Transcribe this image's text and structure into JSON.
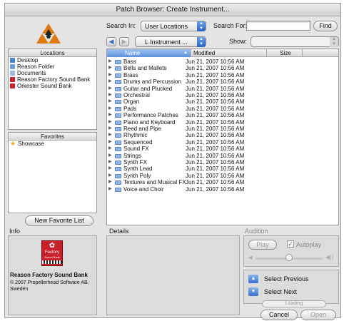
{
  "window": {
    "title": "Patch Browser: Create Instrument..."
  },
  "search": {
    "search_in_label": "Search In:",
    "search_in_value": "User Locations",
    "search_for_label": "Search For:",
    "search_for_value": "",
    "find_label": "Find"
  },
  "toolbar": {
    "path_value": "L Instrument ...",
    "show_label": "Show:",
    "show_value": ""
  },
  "locations": {
    "header": "Locations",
    "items": [
      {
        "label": "Desktop",
        "color": "#4a7fd1"
      },
      {
        "label": "Reason Folder",
        "color": "#6d9bd8"
      },
      {
        "label": "Documents",
        "color": "#9bb9df"
      },
      {
        "label": "Reason Factory Sound Bank",
        "color": "#c8202a"
      },
      {
        "label": "Orkester Sound Bank",
        "color": "#c8202a"
      }
    ]
  },
  "favorites": {
    "header": "Favorites",
    "items": [
      {
        "label": "Showcase"
      }
    ]
  },
  "new_favorite_label": "New Favorite List",
  "file_list": {
    "columns": {
      "name": "Name",
      "modified": "Modified",
      "size": "Size"
    },
    "rows": [
      {
        "name": "Bass",
        "modified": "Jun 21, 2007 10:56 AM"
      },
      {
        "name": "Bells and Mallets",
        "modified": "Jun 21, 2007 10:56 AM"
      },
      {
        "name": "Brass",
        "modified": "Jun 21, 2007 10:56 AM"
      },
      {
        "name": "Drums and Percussion",
        "modified": "Jun 21, 2007 10:56 AM"
      },
      {
        "name": "Guitar and Plucked",
        "modified": "Jun 21, 2007 10:56 AM"
      },
      {
        "name": "Orchestral",
        "modified": "Jun 21, 2007 10:56 AM"
      },
      {
        "name": "Organ",
        "modified": "Jun 21, 2007 10:56 AM"
      },
      {
        "name": "Pads",
        "modified": "Jun 21, 2007 10:56 AM"
      },
      {
        "name": "Performance Patches",
        "modified": "Jun 21, 2007 10:56 AM"
      },
      {
        "name": "Piano and Keyboard",
        "modified": "Jun 21, 2007 10:56 AM"
      },
      {
        "name": "Reed and Pipe",
        "modified": "Jun 21, 2007 10:56 AM"
      },
      {
        "name": "Rhythmic",
        "modified": "Jun 21, 2007 10:56 AM"
      },
      {
        "name": "Sequenced",
        "modified": "Jun 21, 2007 10:56 AM"
      },
      {
        "name": "Sound FX",
        "modified": "Jun 21, 2007 10:56 AM"
      },
      {
        "name": "Strings",
        "modified": "Jun 21, 2007 10:56 AM"
      },
      {
        "name": "Synth FX",
        "modified": "Jun 21, 2007 10:56 AM"
      },
      {
        "name": "Synth Lead",
        "modified": "Jun 21, 2007 10:56 AM"
      },
      {
        "name": "Synth Poly",
        "modified": "Jun 21, 2007 10:56 AM"
      },
      {
        "name": "Textures and Musical FX",
        "modified": "Jun 21, 2007 10:56 AM"
      },
      {
        "name": "Voice and Choir",
        "modified": "Jun 21, 2007 10:56 AM"
      }
    ]
  },
  "info": {
    "header": "Info",
    "badge_text": "Factory",
    "badge_subtext": "Sound Bank",
    "bank_name": "Reason Factory Sound Bank",
    "copyright": "© 2007 Propellerhead Software AB, Sweden"
  },
  "details": {
    "header": "Details"
  },
  "audition": {
    "header": "Audition",
    "play_label": "Play",
    "autoplay_label": "Autoplay",
    "autoplay_checked": true,
    "volume_level": 0.5
  },
  "nav": {
    "select_previous_label": "Select Previous",
    "select_next_label": "Select Next",
    "loading_label": "Loading"
  },
  "buttons": {
    "cancel_label": "Cancel",
    "open_label": "Open"
  },
  "colors": {
    "accent": "#3a6fc9",
    "selection": "#4a7fd1",
    "brand_red": "#c8202a"
  },
  "icons": {
    "logo": "reason-logo-icon",
    "back": "back-arrow-icon",
    "forward": "forward-arrow-icon",
    "favorite": "star-icon",
    "folder": "folder-icon"
  }
}
